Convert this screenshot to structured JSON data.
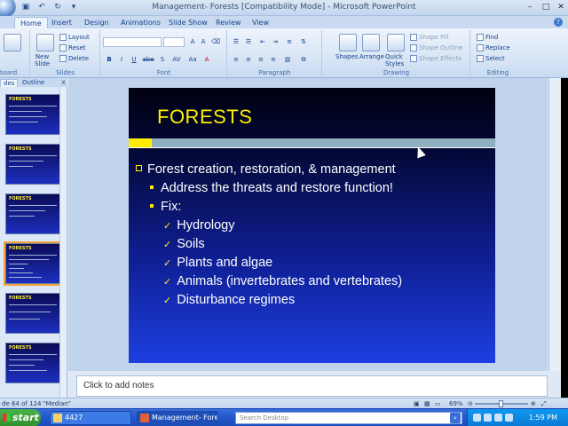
{
  "window": {
    "title": "Management- Forests [Compatibility Mode] - Microsoft PowerPoint"
  },
  "ribbon_tabs": [
    "Home",
    "Insert",
    "Design",
    "Animations",
    "Slide Show",
    "Review",
    "View"
  ],
  "ribbon": {
    "clipboard_label": "board",
    "slides": {
      "new_slide": "New\nSlide",
      "layout": "Layout",
      "reset": "Reset",
      "delete": "Delete",
      "label": "Slides"
    },
    "font": {
      "label": "Font",
      "format_buttons": [
        "B",
        "I",
        "U",
        "abe",
        "S",
        "AV",
        "Aa",
        "A"
      ]
    },
    "paragraph": {
      "label": "Paragraph"
    },
    "drawing": {
      "label": "Drawing",
      "shapes": "Shapes",
      "arrange": "Arrange",
      "quick_styles": "Quick\nStyles",
      "shape_fill": "Shape Fill",
      "shape_outline": "Shape Outline",
      "shape_effects": "Shape Effects"
    },
    "editing": {
      "label": "Editing",
      "find": "Find",
      "replace": "Replace",
      "select": "Select"
    }
  },
  "left_pane": {
    "tabs": [
      "des",
      "Outline"
    ],
    "close": "x",
    "thumbnail_title": "FORESTS"
  },
  "slide": {
    "title": "FORESTS",
    "bullets": [
      {
        "level": 1,
        "text": "Forest creation, restoration, & management"
      },
      {
        "level": 2,
        "text": "Address the threats and restore function!"
      },
      {
        "level": 2,
        "text": "Fix:"
      },
      {
        "level": 3,
        "text": "Hydrology"
      },
      {
        "level": 3,
        "text": "Soils"
      },
      {
        "level": 3,
        "text": "Plants and algae"
      },
      {
        "level": 3,
        "text": "Animals (invertebrates and vertebrates)"
      },
      {
        "level": 3,
        "text": "Disturbance regimes"
      }
    ],
    "colors": {
      "title": "#ffee00",
      "text": "#ffffff",
      "accent": "#ffee00"
    }
  },
  "notes": {
    "placeholder": "Click to add notes"
  },
  "status_bar": {
    "slide_info": "de 64 of 124",
    "theme": "\"Median\"",
    "zoom": "69%"
  },
  "taskbar": {
    "start": "start",
    "tasks": [
      "4427",
      "Management- Forest..."
    ],
    "search_placeholder": "Search Desktop",
    "clock": "1:59 PM"
  }
}
